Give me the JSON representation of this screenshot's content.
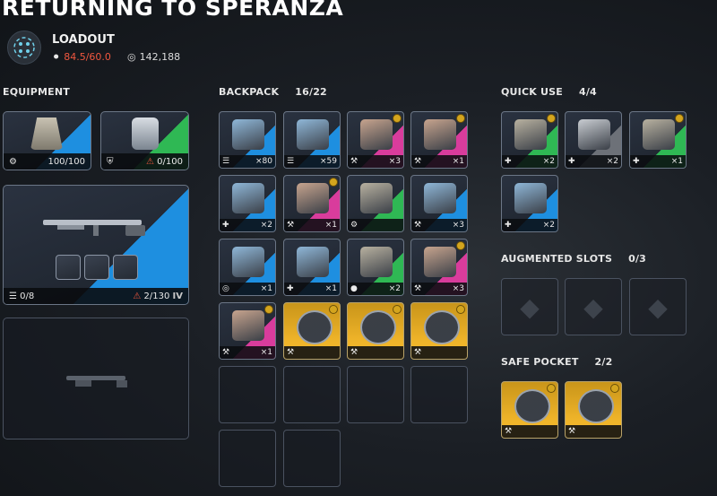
{
  "header": {
    "title": "RETURNING TO SPERANZA",
    "loadout_label": "LOADOUT",
    "weight": "84.5/60.0",
    "coins": "142,188"
  },
  "sections": {
    "equipment": "EQUIPMENT",
    "backpack": "BACKPACK",
    "backpack_count": "16/22",
    "quick_use": "QUICK USE",
    "quick_use_count": "4/4",
    "augmented": "AUGMENTED SLOTS",
    "augmented_count": "0/3",
    "safe_pocket": "SAFE POCKET",
    "safe_pocket_count": "2/2"
  },
  "equipment": {
    "augment_durability": "100/100",
    "shield_durability": "0/100",
    "weapon_ammo": "0/8",
    "weapon_durability": "2/130",
    "weapon_tier": "IV"
  },
  "backpack": [
    {
      "qty": "×80",
      "rarity": "blue",
      "icon": "ammo-icon"
    },
    {
      "qty": "×59",
      "rarity": "blue",
      "icon": "ammo-icon"
    },
    {
      "qty": "×3",
      "rarity": "pink",
      "icon": "wrench-icon"
    },
    {
      "qty": "×1",
      "rarity": "pink",
      "icon": "wrench-icon"
    },
    {
      "qty": "×2",
      "rarity": "blue",
      "icon": "plus-icon"
    },
    {
      "qty": "×1",
      "rarity": "pink",
      "icon": "wrench-icon"
    },
    {
      "qty": "",
      "rarity": "green",
      "icon": "gear-icon"
    },
    {
      "qty": "×3",
      "rarity": "blue",
      "icon": "wrench-icon"
    },
    {
      "qty": "×1",
      "rarity": "blue",
      "icon": "target-icon"
    },
    {
      "qty": "×1",
      "rarity": "blue",
      "icon": "plus-icon"
    },
    {
      "qty": "×2",
      "rarity": "green",
      "icon": "bomb-icon"
    },
    {
      "qty": "×3",
      "rarity": "pink",
      "icon": "wrench-icon"
    },
    {
      "qty": "×1",
      "rarity": "pink",
      "icon": "wrench-icon"
    },
    {
      "qty": "",
      "rarity": "gold",
      "icon": "wrench-icon"
    },
    {
      "qty": "",
      "rarity": "gold",
      "icon": "wrench-icon"
    },
    {
      "qty": "",
      "rarity": "gold",
      "icon": "wrench-icon"
    }
  ],
  "quick_use": [
    {
      "qty": "×2",
      "rarity": "green",
      "icon": "plus-icon"
    },
    {
      "qty": "×2",
      "rarity": "gray",
      "icon": "plus-icon"
    },
    {
      "qty": "×1",
      "rarity": "green",
      "icon": "plus-icon"
    },
    {
      "qty": "×2",
      "rarity": "blue",
      "icon": "plus-icon"
    }
  ],
  "safe_pocket": [
    {
      "qty": "",
      "rarity": "gold",
      "icon": "wrench-icon"
    },
    {
      "qty": "",
      "rarity": "gold",
      "icon": "wrench-icon"
    }
  ]
}
